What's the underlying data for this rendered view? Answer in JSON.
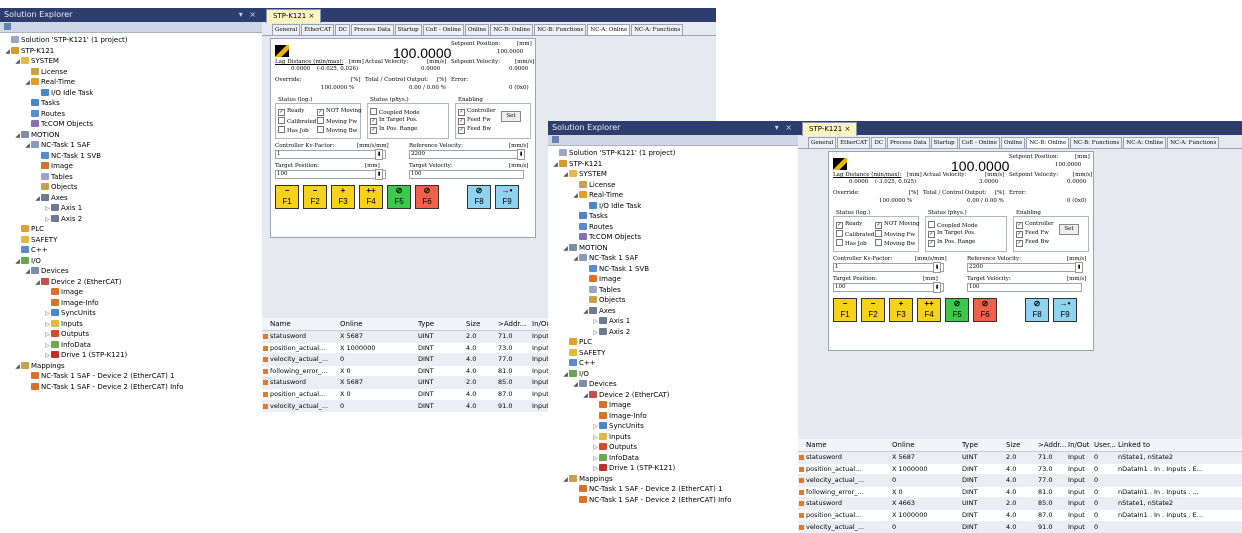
{
  "left_window": {
    "explorer": {
      "title": "Solution Explorer",
      "controls": "▾ ×",
      "items": [
        {
          "text": "Solution 'STP-K121' (1 project)",
          "level": 0,
          "icon": "#9aa6c4",
          "exp": ""
        },
        {
          "text": "STP-K121",
          "level": 0,
          "icon": "#d79a2e",
          "exp": "◢"
        },
        {
          "text": "SYSTEM",
          "level": 1,
          "icon": "#e9b84a",
          "exp": "◢"
        },
        {
          "text": "License",
          "level": 2,
          "icon": "#c8a24b",
          "exp": ""
        },
        {
          "text": "Real-Time",
          "level": 2,
          "icon": "#e39b2a",
          "exp": "◢"
        },
        {
          "text": "I/O Idle Task",
          "level": 3,
          "icon": "#4a86c8",
          "exp": ""
        },
        {
          "text": "Tasks",
          "level": 2,
          "icon": "#4a86c8",
          "exp": ""
        },
        {
          "text": "Routes",
          "level": 2,
          "icon": "#5a8ad0",
          "exp": ""
        },
        {
          "text": "TcCOM Objects",
          "level": 2,
          "icon": "#8b6fb0",
          "exp": ""
        },
        {
          "text": "MOTION",
          "level": 1,
          "icon": "#7f8ca8",
          "exp": "◢"
        },
        {
          "text": "NC-Task 1 SAF",
          "level": 2,
          "icon": "#8a9ab8",
          "exp": "◢"
        },
        {
          "text": "NC-Task 1 SVB",
          "level": 3,
          "icon": "#5a8ad0",
          "exp": ""
        },
        {
          "text": "Image",
          "level": 3,
          "icon": "#d6722a",
          "exp": ""
        },
        {
          "text": "Tables",
          "level": 3,
          "icon": "#9aa6c4",
          "exp": ""
        },
        {
          "text": "Objects",
          "level": 3,
          "icon": "#c8a24b",
          "exp": ""
        },
        {
          "text": "Axes",
          "level": 3,
          "icon": "#6e7a94",
          "exp": "◢"
        },
        {
          "text": "Axis 1",
          "level": 4,
          "icon": "#6e7a94",
          "exp": "▷"
        },
        {
          "text": "Axis 2",
          "level": 4,
          "icon": "#6e7a94",
          "exp": "▷"
        },
        {
          "text": "PLC",
          "level": 1,
          "icon": "#e0a030",
          "exp": ""
        },
        {
          "text": "SAFETY",
          "level": 1,
          "icon": "#e2b93b",
          "exp": ""
        },
        {
          "text": "C++",
          "level": 1,
          "icon": "#5a8ad0",
          "exp": ""
        },
        {
          "text": "I/O",
          "level": 1,
          "icon": "#6aa84f",
          "exp": "◢"
        },
        {
          "text": "Devices",
          "level": 2,
          "icon": "#7f8ca8",
          "exp": "◢"
        },
        {
          "text": "Device 2 (EtherCAT)",
          "level": 3,
          "icon": "#c0504d",
          "exp": "◢"
        },
        {
          "text": "Image",
          "level": 4,
          "icon": "#d6722a",
          "exp": ""
        },
        {
          "text": "Image-Info",
          "level": 4,
          "icon": "#d6722a",
          "exp": ""
        },
        {
          "text": "SyncUnits",
          "level": 4,
          "icon": "#4a86c8",
          "exp": "▷"
        },
        {
          "text": "Inputs",
          "level": 4,
          "icon": "#e2b93b",
          "exp": "▷"
        },
        {
          "text": "Outputs",
          "level": 4,
          "icon": "#d64a2a",
          "exp": "▷"
        },
        {
          "text": "InfoData",
          "level": 4,
          "icon": "#6aa84f",
          "exp": "▷"
        },
        {
          "text": "Drive 1 (STP-K121)",
          "level": 4,
          "icon": "#c0302a",
          "exp": "▷"
        },
        {
          "text": "Mappings",
          "level": 1,
          "icon": "#c8a24b",
          "exp": "◢"
        },
        {
          "text": "NC-Task 1 SAF - Device 2 (EtherCAT) 1",
          "level": 2,
          "icon": "#d6722a",
          "exp": ""
        },
        {
          "text": "NC-Task 1 SAF - Device 2 (EtherCAT) Info",
          "level": 2,
          "icon": "#d6722a",
          "exp": ""
        }
      ]
    },
    "doc_tab": "STP-K121 ×",
    "tabs": [
      "General",
      "EtherCAT",
      "DC",
      "Process Data",
      "Startup",
      "CoE - Online",
      "Online",
      "NC-B: Online",
      "NC-B: Functions",
      "NC-A: Online",
      "NC-A: Functions"
    ],
    "selected_tab": 9,
    "online": {
      "value": "100.0000",
      "setpoint_position_label": "Setpoint Position:",
      "setpoint_position_unit": "[mm]",
      "setpoint_position": "100.0000",
      "lag_label": "Lag Distance (min/max):",
      "lag_unit": "[mm]",
      "lag_value": "0.0000",
      "lag_range": "(-0.025, 0.026)",
      "actual_velocity_label": "Actual Velocity:",
      "actual_velocity_unit": "[mm/s]",
      "actual_velocity": "0.0000",
      "setpoint_velocity_label": "Setpoint Velocity:",
      "setpoint_velocity_unit": "[mm/s]",
      "setpoint_velocity": "0.0000",
      "override_label": "Override:",
      "override_unit": "[%]",
      "override": "100.0000 %",
      "control_output_label": "Total / Control Output:",
      "control_output_unit": "[%]",
      "control_output": "0.00 / 0.00 %",
      "error_label": "Error:",
      "error": "0 (0x0)"
    },
    "status_log": {
      "title": "Status (log.)",
      "items": [
        {
          "label": "Ready",
          "checked": true
        },
        {
          "label": "Calibrated",
          "checked": false
        },
        {
          "label": "Has Job",
          "checked": false
        }
      ]
    },
    "status_log2": [
      {
        "label": "NOT Moving",
        "checked": true
      },
      {
        "label": "Moving Fw",
        "checked": false
      },
      {
        "label": "Moving Bw",
        "checked": false
      }
    ],
    "status_phys": {
      "title": "Status (phys.)",
      "items": [
        {
          "label": "Coupled Mode",
          "checked": false
        },
        {
          "label": "In Target Pos.",
          "checked": true
        },
        {
          "label": "In Pos. Range",
          "checked": true
        }
      ]
    },
    "enabling": {
      "title": "Enabling",
      "items": [
        {
          "label": "Controller",
          "checked": true
        },
        {
          "label": "Feed Fw",
          "checked": true
        },
        {
          "label": "Feed Bw",
          "checked": true
        }
      ],
      "set_label": "Set"
    },
    "kv_label": "Controller Kv-Factor:",
    "kv_unit": "[mm/s/mm]",
    "kv_value": "1",
    "ref_vel_label": "Reference Velocity:",
    "ref_vel_unit": "[mm/s]",
    "ref_vel_value": "2200",
    "target_pos_label": "Target Position:",
    "target_pos_unit": "[mm]",
    "target_pos_value": "100",
    "target_vel_label": "Target Velocity:",
    "target_vel_unit": "[mm/s]",
    "target_vel_value": "100",
    "fbuttons": [
      {
        "sym": "−",
        "label": "F1",
        "color": "#f6d21a"
      },
      {
        "sym": "−",
        "label": "F2",
        "color": "#f6d21a"
      },
      {
        "sym": "+",
        "label": "F3",
        "color": "#f6d21a"
      },
      {
        "sym": "++",
        "label": "F4",
        "color": "#f6d21a"
      },
      {
        "sym": "⊘",
        "label": "F5",
        "color": "#3cc84a"
      },
      {
        "sym": "⊘",
        "label": "F6",
        "color": "#f0604a"
      },
      {
        "sym": "⊘",
        "label": "F8",
        "color": "#8fd3f0"
      },
      {
        "sym": "→•",
        "label": "F9",
        "color": "#8fd3f0"
      }
    ],
    "grid": {
      "columns": [
        "Name",
        "Online",
        "Type",
        "Size",
        ">Addr...",
        "In/Out"
      ],
      "rows": [
        [
          "statusword",
          "X  5687",
          "UINT",
          "2.0",
          "71.0",
          "Input"
        ],
        [
          "position_actual...",
          "X  1000000",
          "DINT",
          "4.0",
          "73.0",
          "Input"
        ],
        [
          "velocity_actual_...",
          "0",
          "DINT",
          "4.0",
          "77.0",
          "Input"
        ],
        [
          "following_error_...",
          "X  0",
          "DINT",
          "4.0",
          "81.0",
          "Input"
        ],
        [
          "statusword",
          "X  5687",
          "UINT",
          "2.0",
          "85.0",
          "Input"
        ],
        [
          "position_actual...",
          "X  0",
          "DINT",
          "4.0",
          "87.0",
          "Input"
        ],
        [
          "velocity_actual_...",
          "0",
          "DINT",
          "4.0",
          "91.0",
          "Input"
        ]
      ]
    }
  },
  "right_window": {
    "explorer": {
      "title": "Solution Explorer",
      "controls": "▾ ×",
      "items": [
        {
          "text": "Solution 'STP-K121' (1 project)",
          "level": 0,
          "icon": "#9aa6c4",
          "exp": ""
        },
        {
          "text": "STP-K121",
          "level": 0,
          "icon": "#d79a2e",
          "exp": "◢"
        },
        {
          "text": "SYSTEM",
          "level": 1,
          "icon": "#e9b84a",
          "exp": "◢"
        },
        {
          "text": "License",
          "level": 2,
          "icon": "#c8a24b",
          "exp": ""
        },
        {
          "text": "Real-Time",
          "level": 2,
          "icon": "#e39b2a",
          "exp": "◢"
        },
        {
          "text": "I/O Idle Task",
          "level": 3,
          "icon": "#4a86c8",
          "exp": ""
        },
        {
          "text": "Tasks",
          "level": 2,
          "icon": "#4a86c8",
          "exp": ""
        },
        {
          "text": "Routes",
          "level": 2,
          "icon": "#5a8ad0",
          "exp": ""
        },
        {
          "text": "TcCOM Objects",
          "level": 2,
          "icon": "#8b6fb0",
          "exp": ""
        },
        {
          "text": "MOTION",
          "level": 1,
          "icon": "#7f8ca8",
          "exp": "◢"
        },
        {
          "text": "NC-Task 1 SAF",
          "level": 2,
          "icon": "#8a9ab8",
          "exp": "◢"
        },
        {
          "text": "NC-Task 1 SVB",
          "level": 3,
          "icon": "#5a8ad0",
          "exp": ""
        },
        {
          "text": "Image",
          "level": 3,
          "icon": "#d6722a",
          "exp": ""
        },
        {
          "text": "Tables",
          "level": 3,
          "icon": "#9aa6c4",
          "exp": ""
        },
        {
          "text": "Objects",
          "level": 3,
          "icon": "#c8a24b",
          "exp": ""
        },
        {
          "text": "Axes",
          "level": 3,
          "icon": "#6e7a94",
          "exp": "◢"
        },
        {
          "text": "Axis 1",
          "level": 4,
          "icon": "#6e7a94",
          "exp": "▷"
        },
        {
          "text": "Axis 2",
          "level": 4,
          "icon": "#6e7a94",
          "exp": "▷"
        },
        {
          "text": "PLC",
          "level": 1,
          "icon": "#e0a030",
          "exp": ""
        },
        {
          "text": "SAFETY",
          "level": 1,
          "icon": "#e2b93b",
          "exp": ""
        },
        {
          "text": "C++",
          "level": 1,
          "icon": "#5a8ad0",
          "exp": ""
        },
        {
          "text": "I/O",
          "level": 1,
          "icon": "#6aa84f",
          "exp": "◢"
        },
        {
          "text": "Devices",
          "level": 2,
          "icon": "#7f8ca8",
          "exp": "◢"
        },
        {
          "text": "Device 2 (EtherCAT)",
          "level": 3,
          "icon": "#c0504d",
          "exp": "◢"
        },
        {
          "text": "Image",
          "level": 4,
          "icon": "#d6722a",
          "exp": ""
        },
        {
          "text": "Image-Info",
          "level": 4,
          "icon": "#d6722a",
          "exp": ""
        },
        {
          "text": "SyncUnits",
          "level": 4,
          "icon": "#4a86c8",
          "exp": "▷"
        },
        {
          "text": "Inputs",
          "level": 4,
          "icon": "#e2b93b",
          "exp": "▷"
        },
        {
          "text": "Outputs",
          "level": 4,
          "icon": "#d64a2a",
          "exp": "▷"
        },
        {
          "text": "InfoData",
          "level": 4,
          "icon": "#6aa84f",
          "exp": "▷"
        },
        {
          "text": "Drive 1 (STP-K121)",
          "level": 4,
          "icon": "#c0302a",
          "exp": "▷"
        },
        {
          "text": "Mappings",
          "level": 1,
          "icon": "#c8a24b",
          "exp": "◢"
        },
        {
          "text": "NC-Task 1 SAF - Device 2 (EtherCAT) 1",
          "level": 2,
          "icon": "#d6722a",
          "exp": ""
        },
        {
          "text": "NC-Task 1 SAF - Device 2 (EtherCAT) Info",
          "level": 2,
          "icon": "#d6722a",
          "exp": ""
        }
      ]
    },
    "doc_tab": "STP-K121 ×",
    "tabs": [
      "General",
      "EtherCAT",
      "DC",
      "Process Data",
      "Startup",
      "CoE - Online",
      "Online",
      "NC-B: Online",
      "NC-B: Functions",
      "NC-A: Online",
      "NC-A: Functions"
    ],
    "selected_tab": 7,
    "online": {
      "value": "100.0000",
      "setpoint_position_label": "Setpoint Position:",
      "setpoint_position_unit": "[mm]",
      "setpoint_position": "100.0000",
      "lag_label": "Lag Distance (min/max):",
      "lag_unit": "[mm]",
      "lag_value": "0.0000",
      "lag_range": "(-3.025, 0.025)",
      "actual_velocity_label": "Actual Velocity:",
      "actual_velocity_unit": "[mm/s]",
      "actual_velocity": "3.0000",
      "setpoint_velocity_label": "Setpoint Velocity:",
      "setpoint_velocity_unit": "[mm/s]",
      "setpoint_velocity": "0.0000",
      "override_label": "Override:",
      "override_unit": "[%]",
      "override": "100.0000 %",
      "control_output_label": "Total / Control Output:",
      "control_output_unit": "[%]",
      "control_output": "0.00 / 0.00 %",
      "error_label": "Error:",
      "error": "0 (0x0)"
    },
    "status_log": {
      "title": "Status (log.)",
      "items": [
        {
          "label": "Ready",
          "checked": true
        },
        {
          "label": "Calibrated",
          "checked": false
        },
        {
          "label": "Has Job",
          "checked": false
        }
      ]
    },
    "status_log2": [
      {
        "label": "NOT Moving",
        "checked": true
      },
      {
        "label": "Moving Fw",
        "checked": false
      },
      {
        "label": "Moving Bw",
        "checked": false
      }
    ],
    "status_phys": {
      "title": "Status (phys.)",
      "items": [
        {
          "label": "Coupled Mode",
          "checked": false
        },
        {
          "label": "In Target Pos.",
          "checked": true
        },
        {
          "label": "In Pos. Range",
          "checked": true
        }
      ]
    },
    "enabling": {
      "title": "Enabling",
      "items": [
        {
          "label": "Controller",
          "checked": true
        },
        {
          "label": "Feed Fw",
          "checked": true
        },
        {
          "label": "Feed Bw",
          "checked": true
        }
      ],
      "set_label": "Set"
    },
    "kv_label": "Controller Kv-Factor:",
    "kv_unit": "[mm/s/mm]",
    "kv_value": "1",
    "ref_vel_label": "Reference Velocity:",
    "ref_vel_unit": "[mm/s]",
    "ref_vel_value": "2200",
    "target_pos_label": "Target Position:",
    "target_pos_unit": "[mm]",
    "target_pos_value": "100",
    "target_vel_label": "Target Velocity:",
    "target_vel_unit": "[mm/s]",
    "target_vel_value": "100",
    "fbuttons": [
      {
        "sym": "−",
        "label": "F1",
        "color": "#f6d21a"
      },
      {
        "sym": "−",
        "label": "F2",
        "color": "#f6d21a"
      },
      {
        "sym": "+",
        "label": "F3",
        "color": "#f6d21a"
      },
      {
        "sym": "++",
        "label": "F4",
        "color": "#f6d21a"
      },
      {
        "sym": "⊘",
        "label": "F5",
        "color": "#3cc84a"
      },
      {
        "sym": "⊘",
        "label": "F6",
        "color": "#f0604a"
      },
      {
        "sym": "⊘",
        "label": "F8",
        "color": "#8fd3f0"
      },
      {
        "sym": "→•",
        "label": "F9",
        "color": "#8fd3f0"
      }
    ],
    "grid": {
      "columns": [
        "Name",
        "Online",
        "Type",
        "Size",
        ">Addr...",
        "In/Out",
        "User...",
        "Linked to"
      ],
      "rows": [
        [
          "statusword",
          "X  5687",
          "UINT",
          "2.0",
          "71.0",
          "Input",
          "0",
          "nState1, nState2"
        ],
        [
          "position_actual...",
          "X  1000000",
          "DINT",
          "4.0",
          "73.0",
          "Input",
          "0",
          "nDataIn1 . In . Inputs . E..."
        ],
        [
          "velocity_actual_...",
          "0",
          "DINT",
          "4.0",
          "77.0",
          "Input",
          "0",
          ""
        ],
        [
          "following_error_...",
          "X  0",
          "DINT",
          "4.0",
          "81.0",
          "Input",
          "0",
          "nDataIn1 . In . Inputs . ..."
        ],
        [
          "statusword",
          "X  4663",
          "UINT",
          "2.0",
          "85.0",
          "Input",
          "0",
          "nState1, nState2"
        ],
        [
          "position_actual...",
          "X  1000000",
          "DINT",
          "4.0",
          "87.0",
          "Input",
          "0",
          "nDataIn1 . In . Inputs . E..."
        ],
        [
          "velocity_actual_...",
          "0",
          "DINT",
          "4.0",
          "91.0",
          "Input",
          "0",
          ""
        ]
      ]
    }
  }
}
